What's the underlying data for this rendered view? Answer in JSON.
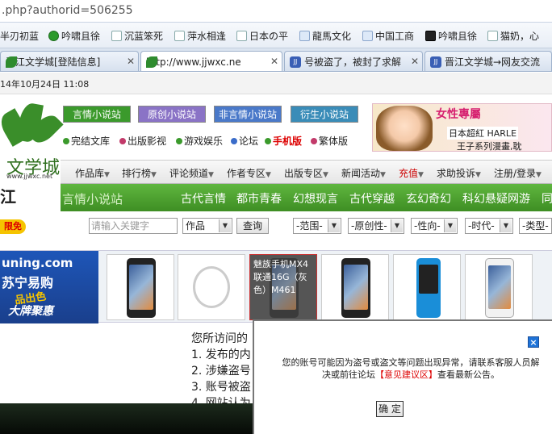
{
  "browser": {
    "address": ".php?authorid=506255",
    "bookmarks": [
      "半刃初蓝",
      "吟啸且徐",
      "沉蓝笨死",
      "萍水相逢",
      "日本の平",
      "龍馬文化",
      "中国工商",
      "吟啸且徐",
      "猫奶，心"
    ],
    "tabs": [
      {
        "title": "晋江文学城[登陆信息]",
        "active": false
      },
      {
        "title": "http://www.jjwxc.ne",
        "active": true
      },
      {
        "title": "号被盗了，被封了求解",
        "active": false
      },
      {
        "title": "晋江文学城→网友交流",
        "active": false
      }
    ],
    "date": "14年10月24日  11:08"
  },
  "header": {
    "logo_text": "文学城",
    "logo_url": "www.jjwxc.net",
    "logo_char": "江",
    "categories": [
      {
        "label": "言情小说站",
        "color": "#3b9a2c"
      },
      {
        "label": "原创小说站",
        "color": "#8a73c6"
      },
      {
        "label": "非言情小说站",
        "color": "#4a79c9"
      },
      {
        "label": "衍生小说站",
        "color": "#3a8cb8"
      }
    ],
    "sub_links": [
      {
        "label": "完结文库",
        "dot": "#3b9a2c",
        "red": false
      },
      {
        "label": "出版影视",
        "dot": "#c23a6a",
        "red": false
      },
      {
        "label": "游戏娱乐",
        "dot": "#3b9a2c",
        "red": false
      },
      {
        "label": "论坛",
        "dot": "#3a6cc9",
        "red": false
      },
      {
        "label": "手机版",
        "dot": "#3b9a2c",
        "red": true
      },
      {
        "label": "繁体版",
        "dot": "#c23a6a",
        "red": false
      }
    ],
    "banner": {
      "t1": "女性專屬",
      "t2": "日本超紅 HARLE",
      "t3": "王子系列漫畫,耽"
    }
  },
  "nav": [
    "作品库",
    "排行榜",
    "评论频道",
    "作者专区",
    "出版专区",
    "新闻活动",
    "充值",
    "求助投诉",
    "注册/登录"
  ],
  "green_bar": {
    "title": "言情小说站",
    "items": [
      "古代言情",
      "都市青春",
      "幻想现言",
      "古代穿越",
      "玄幻奇幻",
      "科幻悬疑网游",
      "同"
    ]
  },
  "search": {
    "badge": "限免",
    "placeholder": "请输入关键字",
    "type_value": "作品",
    "button": "查询",
    "filters": [
      "-范围-",
      "-原创性-",
      "-性向-",
      "-时代-",
      "-类型-"
    ]
  },
  "ad": {
    "brand": "uning.com",
    "brand_cn": "苏宁易购",
    "slogan1": "品出色",
    "slogan2": "大牌聚惠",
    "highlight": "魅族手机MX4 联通16G（灰色）M461"
  },
  "body": {
    "lines": [
      "您所访问的",
      "1. 发布的内",
      "2. 涉嫌盗号",
      "3. 账号被盗",
      "4. 网站认为"
    ]
  },
  "dialog": {
    "close": "×",
    "msg_part1": "您的账号可能因为盗号或盗文等问题出现异常，请联系客服人员解决或前往论坛",
    "msg_link": "【意见建议区】",
    "msg_part2": "查看最新公告。",
    "ok": "确 定"
  }
}
